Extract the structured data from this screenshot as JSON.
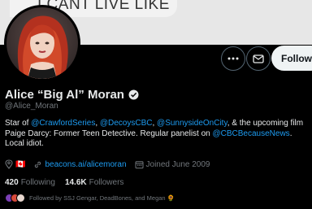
{
  "banner": {
    "text": "I CANT LIVE LIKE THIS"
  },
  "actions": {
    "follow_label": "Follow"
  },
  "profile": {
    "display_name": "Alice “Big Al” Moran",
    "handle": "@Alice_Moran",
    "bio": {
      "p1": "Star of ",
      "l1": "@CrawfordSeries",
      "p2": ", ",
      "l2": "@DecoysCBC",
      "p3": ", ",
      "l3": "@SunnysideOnCity",
      "p4": ", & the upcoming film Paige Darcy: Former Teen Detective. Regular panelist on ",
      "l4": "@CBCBecauseNews",
      "p5": ". Local idiot."
    },
    "location_flag": "🇨🇦",
    "website": "beacons.ai/alicemoran",
    "joined": "Joined June 2009",
    "following_count": "420",
    "following_label": "Following",
    "followers_count": "14.6K",
    "followers_label": "Followers",
    "followed_by": "Followed by SSJ Gengar, DeadBones, and Megan 🌻"
  },
  "colors": {
    "accent": "#1d9bf0",
    "background": "#000000",
    "secondary_text": "#71767b"
  }
}
